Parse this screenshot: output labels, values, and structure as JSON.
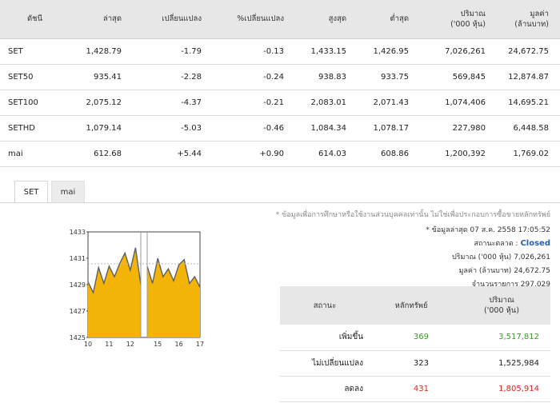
{
  "index_table": {
    "headers": [
      "ดัชนี",
      "ล่าสุด",
      "เปลี่ยนแปลง",
      "%เปลี่ยนแปลง",
      "สูงสุด",
      "ต่ำสุด",
      "ปริมาณ",
      "('000 หุ้น)",
      "มูลค่า",
      "(ล้านบาท)"
    ],
    "rows": [
      {
        "name": "SET",
        "last": "1,428.79",
        "change": "-1.79",
        "pct": "-0.13",
        "high": "1,433.15",
        "low": "1,426.95",
        "volume": "7,026,261",
        "value": "24,672.75"
      },
      {
        "name": "SET50",
        "last": "935.41",
        "change": "-2.28",
        "pct": "-0.24",
        "high": "938.83",
        "low": "933.75",
        "volume": "569,845",
        "value": "12,874.87"
      },
      {
        "name": "SET100",
        "last": "2,075.12",
        "change": "-4.37",
        "pct": "-0.21",
        "high": "2,083.01",
        "low": "2,071.43",
        "volume": "1,074,406",
        "value": "14,695.21"
      },
      {
        "name": "SETHD",
        "last": "1,079.14",
        "change": "-5.03",
        "pct": "-0.46",
        "high": "1,084.34",
        "low": "1,078.17",
        "volume": "227,980",
        "value": "6,448.58"
      },
      {
        "name": "mai",
        "last": "612.68",
        "change": "+5.44",
        "pct": "+0.90",
        "high": "614.03",
        "low": "608.86",
        "volume": "1,200,392",
        "value": "1,769.02"
      }
    ]
  },
  "tabs": [
    "SET",
    "mai"
  ],
  "notice": "* ข้อมูลเพื่อการศึกษาหรือใช้งานส่วนบุคคลเท่านั้น ไม่ใช่เพื่อประกอบการซื้อขายหลักทรัพย์",
  "info": {
    "updated": "* ข้อมูลล่าสุด 07 ส.ค. 2558 17:05:52",
    "status_label": "สถานะตลาด :",
    "status_value": "Closed",
    "volume_label": "ปริมาณ ('000 หุ้น)",
    "volume_value": "7,026,261",
    "value_label": "มูลค่า (ล้านบาท)",
    "value_value": "24,672.75",
    "deals_label": "จำนวนรายการ",
    "deals_value": "297,029"
  },
  "summary": {
    "headers": [
      "สถานะ",
      "หลักทรัพย์",
      "ปริมาณ",
      "('000 หุ้น)"
    ],
    "rows": [
      {
        "status": "เพิ่มขึ้น",
        "count": "369",
        "volume": "3,517,812",
        "color": "#3a9a2a"
      },
      {
        "status": "ไม่เปลี่ยนแปลง",
        "count": "323",
        "volume": "1,525,984",
        "color": "#222222"
      },
      {
        "status": "ลดลง",
        "count": "431",
        "volume": "1,805,914",
        "color": "#d9261c"
      }
    ]
  },
  "chart_data": {
    "type": "area",
    "ylim": [
      1425,
      1433
    ],
    "yticks": [
      "1433",
      "1431",
      "1429",
      "1427",
      "1425"
    ],
    "xticks": [
      "10",
      "11",
      "12",
      "15",
      "16",
      "17"
    ],
    "previous_close": 1430.58,
    "sessions": [
      {
        "name": "morning",
        "x": [
          10.0,
          10.25,
          10.5,
          10.75,
          11.0,
          11.25,
          11.5,
          11.75,
          12.0,
          12.25,
          12.5
        ],
        "y": [
          1429.2,
          1428.4,
          1430.3,
          1429.1,
          1430.4,
          1429.6,
          1430.6,
          1431.4,
          1430.1,
          1431.8,
          1429.0
        ]
      },
      {
        "name": "afternoon",
        "x": [
          14.5,
          14.75,
          15.0,
          15.25,
          15.5,
          15.75,
          16.0,
          16.25,
          16.5,
          16.75,
          17.0
        ],
        "y": [
          1430.4,
          1429.1,
          1431.0,
          1429.6,
          1430.2,
          1429.3,
          1430.5,
          1430.9,
          1429.1,
          1429.6,
          1428.8
        ]
      }
    ],
    "colors": {
      "fill": "#f3b407",
      "line": "#5f5f5f",
      "frame": "#444444",
      "ref": "#bbbbbb"
    }
  }
}
